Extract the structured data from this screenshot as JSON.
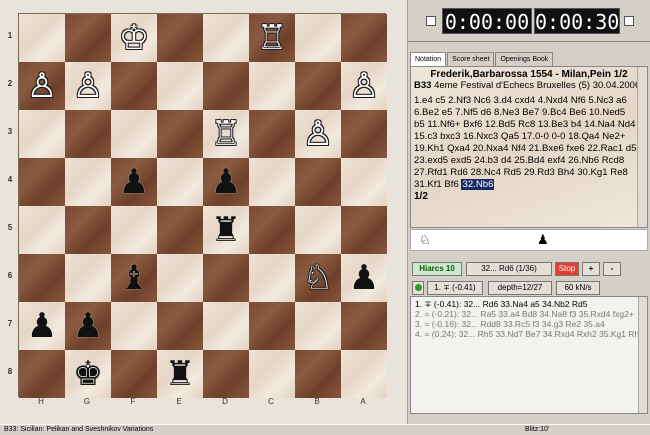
{
  "board": {
    "rank_labels": [
      "1",
      "2",
      "3",
      "4",
      "5",
      "6",
      "7",
      "8"
    ],
    "file_labels": [
      "H",
      "G",
      "F",
      "E",
      "D",
      "C",
      "B",
      "A"
    ],
    "rows": [
      [
        "",
        "",
        "wK",
        "",
        "",
        "wR",
        "",
        ""
      ],
      [
        "wP",
        "wP",
        "",
        "",
        "",
        "",
        "",
        "wP"
      ],
      [
        "",
        "",
        "",
        "",
        "wR",
        "",
        "wP",
        ""
      ],
      [
        "",
        "",
        "bP",
        "",
        "bP",
        "",
        "",
        ""
      ],
      [
        "",
        "",
        "",
        "",
        "bR",
        "",
        "",
        ""
      ],
      [
        "",
        "",
        "bB",
        "",
        "",
        "",
        "wN",
        "bP"
      ],
      [
        "bP",
        "bP",
        "",
        "",
        "",
        "",
        "",
        ""
      ],
      [
        "",
        "bK",
        "",
        "bR",
        "",
        "",
        "",
        ""
      ]
    ],
    "piece_glyphs": {
      "wK": "♔",
      "wQ": "♕",
      "wR": "♖",
      "wB": "♗",
      "wN": "♘",
      "wP": "♙",
      "bK": "♚",
      "bQ": "♛",
      "bR": "♜",
      "bB": "♝",
      "bN": "♞",
      "bP": "♟"
    }
  },
  "clocks": {
    "white": "0:00:00",
    "black": "0:00:30"
  },
  "tabs": [
    "Notation",
    "Score sheet",
    "Openings Book"
  ],
  "game": {
    "header": "Frederik,Barbarossa 1554 - Milan,Pein  1/2",
    "eco": "B33",
    "event": " 4eme Festival d'Echecs Bruxelles (5) 30.04.2006",
    "moves_before": "1.e4 c5 2.Nf3 Nc6 3.d4 cxd4 4.Nxd4 Nf6 5.Nc3 a6 6.Be2 e5 7.Nf5 d6 8.Ne3 Be7 9.Bc4 Be6 10.Ned5 b5 11.Nf6+ Bxf6 12.Bd5 Rc8 13.Be3 b4 14.Na4 Nd4 15.c3 bxc3 16.Nxc3 Qa5 17.0-0 0-0 18.Qa4 Ne2+ 19.Kh1 Qxa4 20.Nxa4 Nf4 21.Bxe6 fxe6 22.Rac1 d5 23.exd5 exd5 24.b3 d4 25.Bd4 exf4 26.Nb6 Rcd8 27.Rfd1 Rd6 28.Nc4 Rd5 29.Rd3 Bh4 30.Kg1 Re8 31.Kf1 Bf6",
    "current_move": "32.Nb6",
    "result": "1/2"
  },
  "engine": {
    "name": "Hiarcs 10",
    "move_info": "32... Rd6 (1/36)",
    "stop_label": "Stop",
    "plus_label": "+",
    "minus_label": "-",
    "eval": "1. ∓ (-0.41)",
    "depth": "depth=12/27",
    "speed": "60 kN/s",
    "lines": [
      "1. ∓ (-0.41): 32... Rd6 33.Na4 a5 34.Nb2 Rd5",
      "2. = (-0.21): 32... Ra5 33.a4 Bd8 34.Na8 f3 35.Rxd4 fxg2+",
      "3. = (-0.16): 32... Rdd8 33.Rc5 f3 34.g3 Re2 35.a4",
      "4. = (0.24): 32... Rh5 33.Nd7 Be7 34.Rxd4 Rxh2 35.Kg1 Rh"
    ]
  },
  "status": {
    "opening": "B33: Sicilian: Pelikan and Sveshnikov Variations",
    "blitz": "Blitz:10'"
  }
}
